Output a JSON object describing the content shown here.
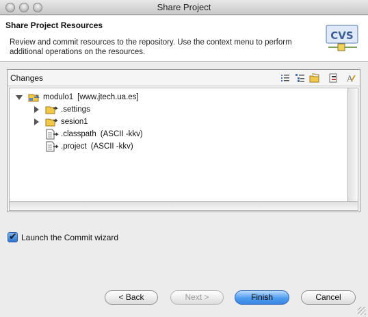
{
  "window": {
    "title": "Share Project"
  },
  "header": {
    "title": "Share Project Resources",
    "description": "Review and commit resources to the repository. Use the context menu to perform additional operations on the resources.",
    "logo_text": "CVS"
  },
  "changes": {
    "title": "Changes",
    "toolbar": [
      {
        "name": "flat-mode-icon"
      },
      {
        "name": "tree-mode-icon"
      },
      {
        "name": "compressed-folders-icon"
      },
      {
        "name": "collapse-all-icon"
      },
      {
        "name": "show-comments-icon"
      }
    ],
    "tree": [
      {
        "label": "modulo1",
        "meta": "[www.jtech.ua.es]",
        "level": 0,
        "arrow": "down",
        "icon": "project"
      },
      {
        "label": ".settings",
        "meta": "",
        "level": 1,
        "arrow": "right",
        "icon": "folder"
      },
      {
        "label": "sesion1",
        "meta": "",
        "level": 1,
        "arrow": "right",
        "icon": "folder"
      },
      {
        "label": ".classpath",
        "meta": "(ASCII -kkv)",
        "level": 1,
        "arrow": "",
        "icon": "file"
      },
      {
        "label": ".project",
        "meta": "(ASCII -kkv)",
        "level": 1,
        "arrow": "",
        "icon": "file"
      }
    ]
  },
  "options": {
    "launch_commit_label": "Launch the Commit wizard",
    "launch_commit_checked": true
  },
  "buttons": {
    "back": "< Back",
    "next": "Next >",
    "finish": "Finish",
    "cancel": "Cancel"
  },
  "colors": {
    "accent": "#3b86e2",
    "header_bg": "#ffffff",
    "window_bg": "#ececec"
  }
}
